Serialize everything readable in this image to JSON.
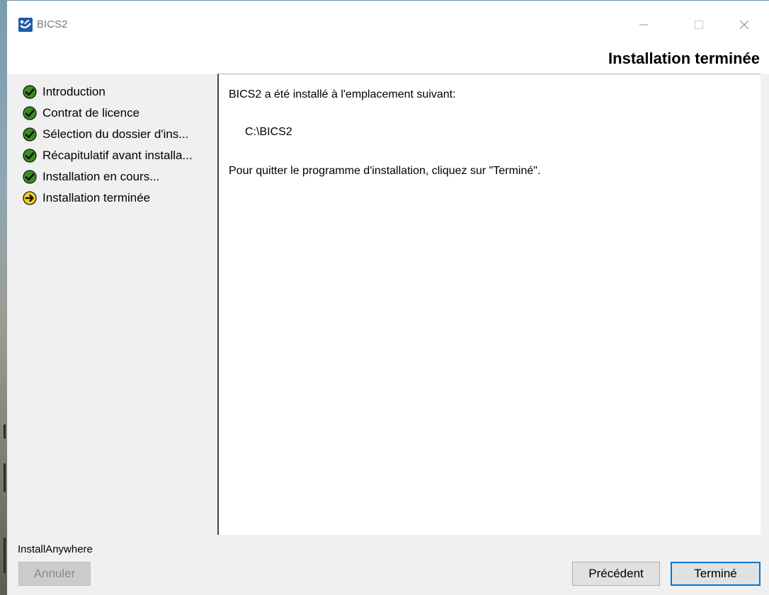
{
  "window": {
    "title": "BICS2",
    "icon": "bics-app-icon",
    "controls": [
      "minimize-icon",
      "maximize-icon",
      "close-icon"
    ]
  },
  "header": {
    "title": "Installation terminée"
  },
  "steps": [
    {
      "label": "Introduction",
      "status": "done",
      "icon": "check-icon"
    },
    {
      "label": "Contrat de licence",
      "status": "done",
      "icon": "check-icon"
    },
    {
      "label": "Sélection du dossier d'ins...",
      "status": "done",
      "icon": "check-icon"
    },
    {
      "label": "Récapitulatif avant installa...",
      "status": "done",
      "icon": "check-icon"
    },
    {
      "label": "Installation en cours...",
      "status": "done",
      "icon": "check-icon"
    },
    {
      "label": "Installation terminée",
      "status": "current",
      "icon": "arrow-right-icon"
    }
  ],
  "content": {
    "installed_message": "BICS2 a été installé à l'emplacement suivant:",
    "install_path": "C:\\BICS2",
    "quit_message": "Pour quitter le programme d'installation, cliquez sur \"Terminé\"."
  },
  "footer": {
    "vendor": "InstallAnywhere",
    "cancel_label": "Annuler",
    "back_label": "Précédent",
    "done_label": "Terminé"
  },
  "colors": {
    "done_icon": "#3a8f1e",
    "current_icon": "#f2d21b",
    "focus_border": "#0078d7",
    "brand": "#1e5ba8"
  }
}
